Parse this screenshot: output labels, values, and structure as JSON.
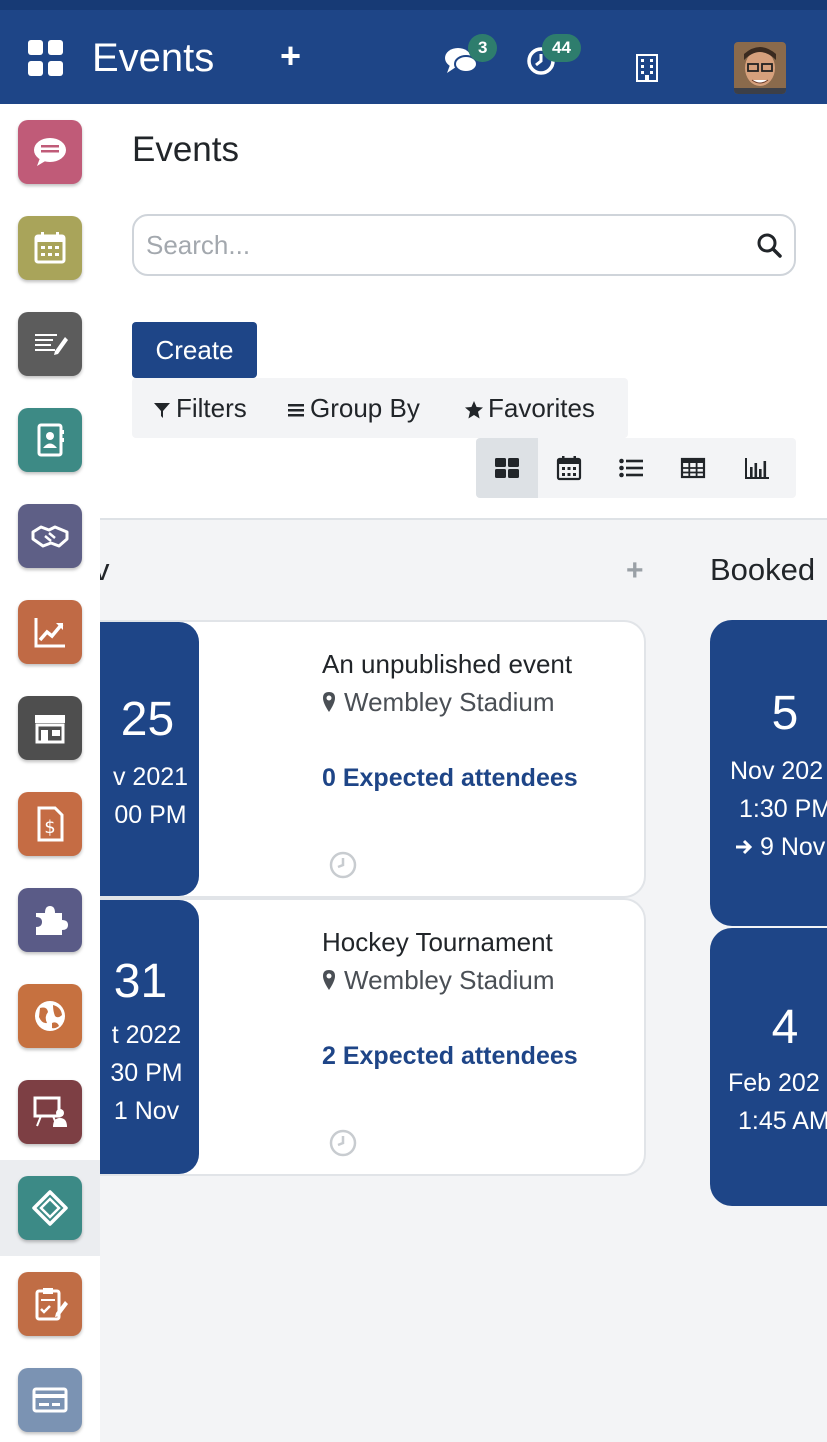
{
  "topbar": {
    "title": "Events",
    "plus": "+",
    "messages_count": "3",
    "activities_count": "44",
    "icons": [
      "apps-grid-icon",
      "chat-icon",
      "clock-icon",
      "building-icon",
      "user-avatar"
    ]
  },
  "sidebar": {
    "apps": [
      {
        "icon": "chat-icon",
        "color": "#c05b78"
      },
      {
        "icon": "calendar-icon",
        "color": "#a9a45a"
      },
      {
        "icon": "notes-icon",
        "color": "#5c5c5c"
      },
      {
        "icon": "contacts-icon",
        "color": "#3d8a85"
      },
      {
        "icon": "handshake-icon",
        "color": "#5e5f86"
      },
      {
        "icon": "chart-icon",
        "color": "#c06a45"
      },
      {
        "icon": "shop-icon",
        "color": "#4e4e4e"
      },
      {
        "icon": "invoice-icon",
        "color": "#c56c44"
      },
      {
        "icon": "puzzle-icon",
        "color": "#5a5b87"
      },
      {
        "icon": "globe-icon",
        "color": "#c67140"
      },
      {
        "icon": "presentation-icon",
        "color": "#7d3f44"
      },
      {
        "icon": "ticket-icon",
        "color": "#3c8a86"
      },
      {
        "icon": "survey-icon",
        "color": "#c06d45"
      },
      {
        "icon": "card-icon",
        "color": "#7b93b3"
      }
    ],
    "active_index": 11
  },
  "control": {
    "title": "Events",
    "search_placeholder": "Search...",
    "create_label": "Create",
    "filters_label": "Filters",
    "groupby_label": "Group By",
    "favorites_label": "Favorites",
    "views": [
      "kanban",
      "calendar",
      "list",
      "pivot",
      "graph"
    ],
    "active_view": "kanban"
  },
  "kanban": {
    "columns": [
      {
        "title": "v",
        "add": "+",
        "cards": [
          {
            "day": "25",
            "line1": "v 2021",
            "line2": "00 PM",
            "line3": "",
            "name": "An unpublished event",
            "location": "Wembley Stadium",
            "attendees": "0 Expected attendees"
          },
          {
            "day": "31",
            "line1": "t 2022",
            "line2": "30 PM",
            "line3": "1 Nov",
            "name": "Hockey Tournament",
            "location": "Wembley Stadium",
            "attendees": "2 Expected attendees"
          }
        ]
      },
      {
        "title": "Booked",
        "cards": [
          {
            "day": "5",
            "line1": "Nov 202",
            "line2": "1:30 PM",
            "line3": "9 Nov"
          },
          {
            "day": "4",
            "line1": "Feb 202",
            "line2": "1:45 AM",
            "line3": ""
          }
        ]
      }
    ]
  }
}
